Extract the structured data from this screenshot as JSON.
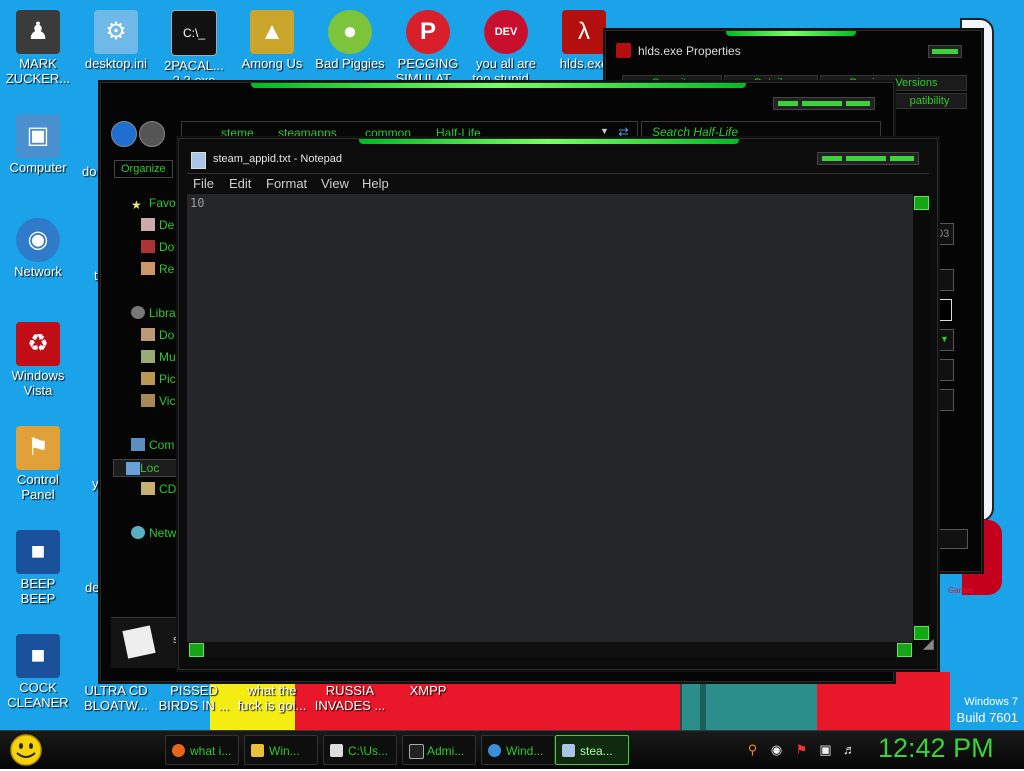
{
  "desktop": {
    "icons": [
      {
        "label": "MARK\nZUCKER...",
        "icon": "user-folder-icon",
        "color": "#3b3b3b"
      },
      {
        "label": "desktop.ini",
        "icon": "settings-file-icon",
        "color": "#6fb9e8"
      },
      {
        "label": "2PACAL...\n2.3.exe",
        "icon": "console-icon",
        "color": "#111111"
      },
      {
        "label": "Among Us",
        "icon": "among-us-icon",
        "color": "#caa52b"
      },
      {
        "label": "Bad Piggies",
        "icon": "bad-piggies-icon",
        "color": "#7cc43b"
      },
      {
        "label": "PEGGING\nSIMULAT...",
        "icon": "pegging-icon",
        "color": "#d81f2a"
      },
      {
        "label": "you all are\ntoo stupid...",
        "icon": "dev-cpp-icon",
        "color": "#c8102e"
      },
      {
        "label": "hlds.exe",
        "icon": "half-life-icon",
        "color": "#b40f0f"
      },
      {
        "label": "Computer",
        "icon": "computer-icon",
        "color": "#4a8fd0"
      },
      {
        "label": "Network",
        "icon": "network-icon",
        "color": "#2f7ac9"
      },
      {
        "label": "Windows\nVista",
        "icon": "recycle-bin-icon",
        "color": "#c00d16"
      },
      {
        "label": "Control\nPanel",
        "icon": "control-panel-icon",
        "color": "#e2a038"
      },
      {
        "label": "BEEP\nBEEP",
        "icon": "blue-app-icon",
        "color": "#1a4f9a"
      },
      {
        "label": "COCK\nCLEANER",
        "icon": "blue-box-icon",
        "color": "#1a4f9a"
      },
      {
        "label": "ULTRA CD\nBLOATW...",
        "icon": "cd-icon",
        "color": "#7a7a7a"
      },
      {
        "label": "PISSED\nBIRDS IN ...",
        "icon": "birds-icon",
        "color": "#c00d16"
      },
      {
        "label": "what the\nfuck is goi...",
        "icon": "text-file-icon",
        "color": "#e6e6e6"
      },
      {
        "label": "RUSSIA\nINVADES ...",
        "icon": "flag-icon",
        "color": "#c00d16"
      },
      {
        "label": "XMPP",
        "icon": "xmpp-icon",
        "color": "#e07020"
      }
    ],
    "partial_labels": [
      "do",
      "t",
      "y",
      "de"
    ]
  },
  "properties_window": {
    "title": "hlds.exe Properties",
    "tabs": [
      "Security",
      "Details",
      "Previous Versions"
    ],
    "active_tab": "patibility",
    "partial_value": "03",
    "partial_games": "Games"
  },
  "explorer_window": {
    "breadcrumbs": [
      "steme",
      "steamapps",
      "common",
      "Half-Life"
    ],
    "search_placeholder": "Search Half-Life",
    "organize_label": "Organize",
    "nav": [
      {
        "label": "Favo",
        "icon": "star-icon",
        "indent": false
      },
      {
        "label": "De",
        "icon": "desktop-folder-icon",
        "indent": true
      },
      {
        "label": "Do",
        "icon": "downloads-folder-icon",
        "indent": true
      },
      {
        "label": "Re",
        "icon": "recent-places-icon",
        "indent": true
      },
      {
        "label": "Libra",
        "icon": "libraries-icon",
        "indent": false
      },
      {
        "label": "Do",
        "icon": "documents-icon",
        "indent": true
      },
      {
        "label": "Mu",
        "icon": "music-icon",
        "indent": true
      },
      {
        "label": "Pic",
        "icon": "pictures-icon",
        "indent": true
      },
      {
        "label": "Vic",
        "icon": "videos-icon",
        "indent": true
      },
      {
        "label": "Com",
        "icon": "computer-icon",
        "indent": false
      },
      {
        "label": "Loc",
        "icon": "local-disk-icon",
        "indent": true
      },
      {
        "label": "CD",
        "icon": "cd-drive-icon",
        "indent": true
      },
      {
        "label": "Netw",
        "icon": "network-icon",
        "indent": false
      }
    ],
    "status_partial": "s"
  },
  "notepad": {
    "title": "steam_appid.txt - Notepad",
    "menu": [
      "File",
      "Edit",
      "Format",
      "View",
      "Help"
    ],
    "content": "10"
  },
  "taskbar": {
    "buttons": [
      {
        "label": "what i...",
        "icon": "firefox-icon",
        "color": "#e8661c",
        "active": false
      },
      {
        "label": "Win...",
        "icon": "explorer-folder-icon",
        "color": "#e8c13c",
        "active": false
      },
      {
        "label": "C:\\Us...",
        "icon": "7zip-icon",
        "color": "#dddddd",
        "active": false
      },
      {
        "label": "Admi...",
        "icon": "cmd-icon",
        "color": "#222222",
        "active": false
      },
      {
        "label": "Wind...",
        "icon": "ie-icon",
        "color": "#3a8fd8",
        "active": false
      },
      {
        "label": "stea...",
        "icon": "notepad-icon",
        "color": "#a9c6e6",
        "active": true
      }
    ],
    "clock": "12:42 PM",
    "tray_icons": [
      "search-icon",
      "status-icon",
      "action-center-flag-icon",
      "network-tray-icon",
      "volume-icon"
    ]
  },
  "watermark": {
    "line1": "Windows 7",
    "line2": "Build 7601"
  },
  "colors": {
    "accent_green": "#2ec92e",
    "desktop_blue": "#1aa3e8"
  }
}
